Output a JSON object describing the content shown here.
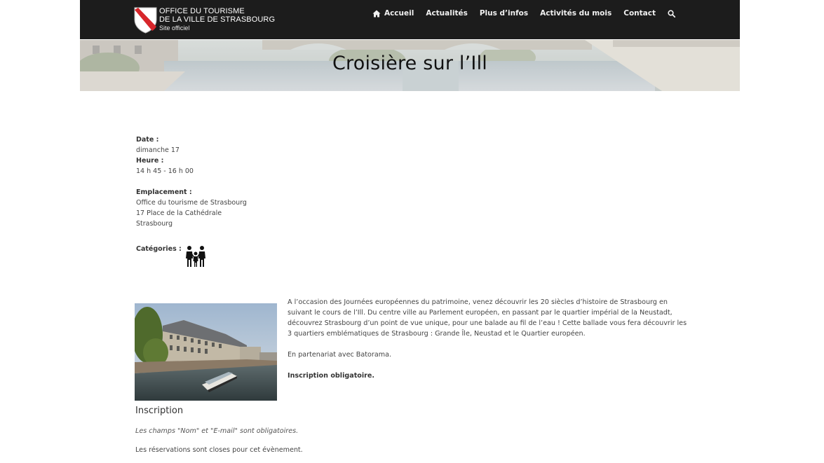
{
  "header": {
    "logo_line1": "OFFICE DU TOURISME",
    "logo_line2": "DE LA VILLE DE STRASBOURG",
    "logo_line3": "Site officiel",
    "nav": [
      {
        "label": "Accueil",
        "icon": "home-icon"
      },
      {
        "label": "Actualités"
      },
      {
        "label": "Plus d’infos"
      },
      {
        "label": "Activités du mois"
      },
      {
        "label": "Contact"
      }
    ],
    "search_icon": "search-icon"
  },
  "banner": {
    "title": "Croisière sur l’Ill"
  },
  "event": {
    "date_label": "Date :",
    "date_value": "dimanche 17",
    "time_label": "Heure :",
    "time_value": "14 h 45 - 16 h 00",
    "location_label": "Emplacement :",
    "location_lines": [
      "Office du tourisme de Strasbourg",
      "17 Place de la Cathédrale",
      "Strasbourg"
    ],
    "categories_label": "Catégories :",
    "category_icon": "family-icon"
  },
  "description": {
    "paragraph1": "A l’occasion des Journées européennes du patrimoine, venez découvrir les 20 siècles d’histoire de Strasbourg en suivant le cours de l’Ill. Du centre ville au Parlement européen, en passant par le quartier impérial de la Neustadt, découvrez Strasbourg d’un point de vue unique, pour une balade au fil de l’eau ! Cette ballade vous fera découvrir les 3 quartiers emblématiques de Strasbourg : Grande Île, Neustad et le Quartier européen.",
    "paragraph2": "En partenariat avec Batorama.",
    "paragraph3": "Inscription obligatoire."
  },
  "registration": {
    "title": "Inscription",
    "note": "Les champs \"Nom\" et \"E-mail\" sont obligatoires.",
    "closed": "Les réservations sont closes pour cet évènement."
  },
  "colors": {
    "topbar": "#1c1c1c",
    "shield_red": "#d7262b"
  }
}
